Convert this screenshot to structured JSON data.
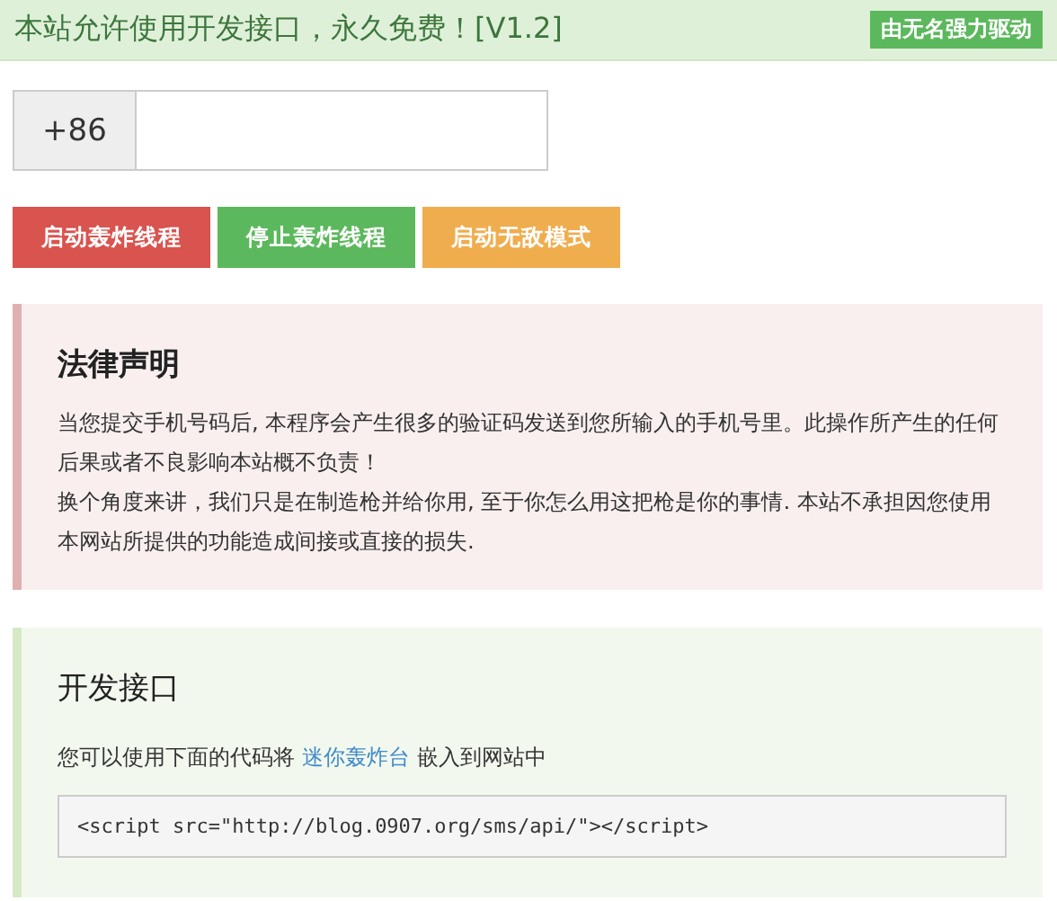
{
  "header": {
    "title": "本站允许使用开发接口，永久免费！[V1.2]",
    "badge": "由无名强力驱动"
  },
  "phone": {
    "prefix": "+86"
  },
  "buttons": [
    {
      "label": "启动轰炸线程",
      "kind": "danger"
    },
    {
      "label": "停止轰炸线程",
      "kind": "success"
    },
    {
      "label": "启动无敌模式",
      "kind": "warning"
    }
  ],
  "notices": [
    {
      "kind": "danger",
      "title": "法律声明",
      "paragraphs": [
        "当您提交手机号码后, 本程序会产生很多的验证码发送到您所输入的手机号里。此操作所产生的任何后果或者不良影响本站概不负责！",
        "换个角度来讲，我们只是在制造枪并给你用, 至于你怎么用这把枪是你的事情. 本站不承担因您使用本网站所提供的功能造成间接或直接的损失."
      ]
    },
    {
      "kind": "success",
      "title": "开发接口",
      "intro_before": "您可以使用下面的代码将",
      "link": "迷你轰炸台",
      "intro_after": "嵌入到网站中",
      "code": "<script src=\"http://blog.0907.org/sms/api/\"></script>"
    }
  ]
}
